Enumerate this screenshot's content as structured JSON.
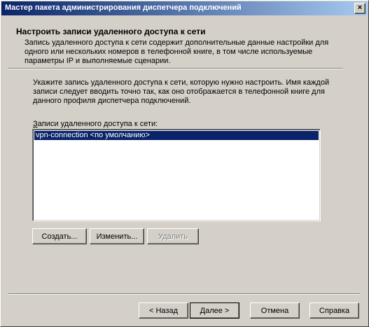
{
  "window": {
    "title": "Мастер пакета администрирования диспетчера подключений",
    "close_glyph": "×"
  },
  "header": {
    "title": "Настроить записи удаленного доступа к сети",
    "description": "Запись удаленного доступа к сети содержит дополнительные данные настройки для одного или нескольких номеров в телефонной книге, в том числе используемые параметры IP и выполняемые сценарии."
  },
  "main": {
    "instructions": "Укажите запись удаленного доступа к сети, которую нужно настроить. Имя каждой записи следует вводить точно так, как оно отображается в телефонной книге для данного профиля диспетчера подключений.",
    "list_label_accel": "З",
    "list_label_rest": "аписи удаленного доступа к сети:",
    "list_items": [
      {
        "label": "vpn-connection <по умолчанию>",
        "selected": true
      }
    ],
    "buttons": {
      "create": "Создать...",
      "edit": "Изменить...",
      "delete": "Удалить"
    }
  },
  "footer": {
    "back": "< Назад",
    "next": "Далее >",
    "cancel": "Отмена",
    "help": "Справка"
  },
  "colors": {
    "face": "#d4d0c8",
    "selection": "#0a246a",
    "titlebar_start": "#0a246a",
    "titlebar_end": "#a6caf0"
  }
}
